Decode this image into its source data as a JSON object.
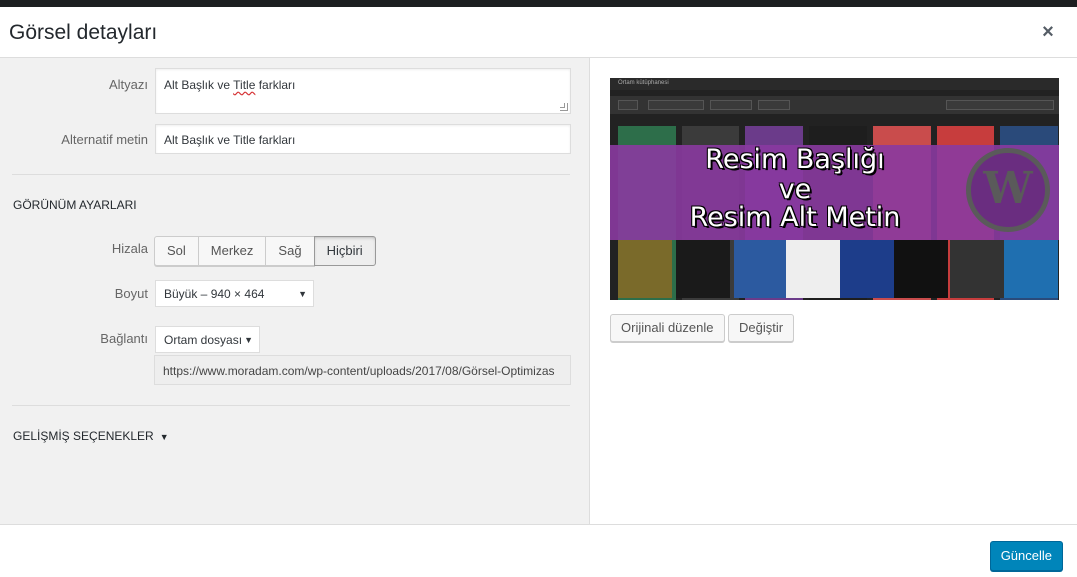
{
  "dialog": {
    "title": "Görsel detayları",
    "close_label": "×"
  },
  "fields": {
    "caption_label": "Altyazı",
    "caption_value_before": "Alt Başlık ve ",
    "caption_value_misspelled": "Title",
    "caption_value_after": " farkları",
    "alt_label": "Alternatif metin",
    "alt_value": "Alt Başlık ve Title farkları"
  },
  "display_settings": {
    "section_title": "GÖRÜNÜM AYARLARI",
    "align_label": "Hizala",
    "align_options": [
      "Sol",
      "Merkez",
      "Sağ",
      "Hiçbiri"
    ],
    "align_selected": "Hiçbiri",
    "size_label": "Boyut",
    "size_value": "Büyük – 940 × 464",
    "link_label": "Bağlantı",
    "link_value": "Ortam dosyası",
    "link_url": "https://www.moradam.com/wp-content/uploads/2017/08/Görsel-Optimizas"
  },
  "advanced": {
    "label": "GELİŞMİŞ SEÇENEKLER"
  },
  "preview": {
    "library_title": "Ortam kütüphanesi",
    "banner_line1": "Resim Başlığı",
    "banner_line2": "ve",
    "banner_line3": "Resim Alt Metin",
    "logo_letter": "W"
  },
  "actions": {
    "edit_original": "Orijinali düzenle",
    "replace": "Değiştir",
    "update": "Güncelle"
  },
  "colors": {
    "primary": "#0085ba",
    "banner": "#8a3aa0"
  }
}
